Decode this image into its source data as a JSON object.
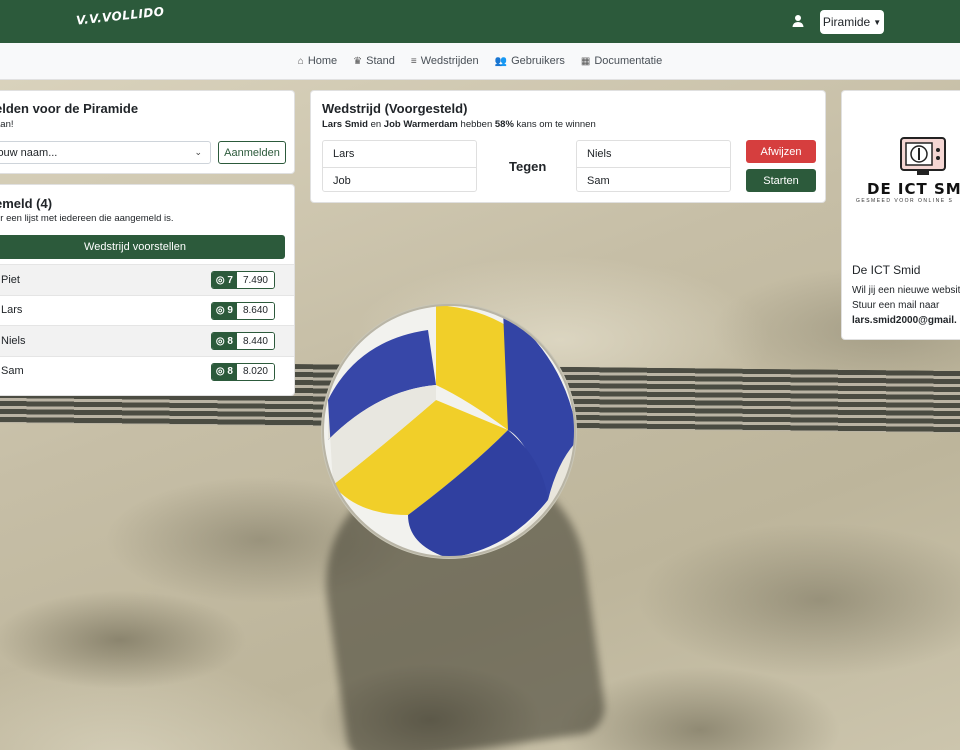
{
  "header": {
    "logo_text": "V.V.VOLLIDO",
    "dropdown_label": "Piramide"
  },
  "nav": {
    "items": [
      {
        "label": "Home",
        "icon": "home-icon"
      },
      {
        "label": "Stand",
        "icon": "crown-icon"
      },
      {
        "label": "Wedstrijden",
        "icon": "list-icon"
      },
      {
        "label": "Gebruikers",
        "icon": "users-icon"
      },
      {
        "label": "Documentatie",
        "icon": "boxes-icon"
      }
    ]
  },
  "signup": {
    "title": "elden voor de Piramide",
    "subtitle": "aan!",
    "select_value": "jouw naam...",
    "button": "Aanmelden"
  },
  "registered": {
    "title": "emeld (4)",
    "subtitle": "er een lijst met iedereen die aangemeld is.",
    "propose_button": "Wedstrijd voorstellen",
    "players": [
      {
        "name": "Piet",
        "rank": "7",
        "score": "7.490"
      },
      {
        "name": "Lars",
        "rank": "9",
        "score": "8.640"
      },
      {
        "name": "Niels",
        "rank": "8",
        "score": "8.440"
      },
      {
        "name": "Sam",
        "rank": "8",
        "score": "8.020"
      }
    ]
  },
  "match": {
    "title": "Wedstrijd (Voorgesteld)",
    "player_a": "Lars Smid",
    "joiner": "en",
    "player_b": "Job Warmerdam",
    "verb": "hebben",
    "chance": "58%",
    "suffix": "kans om te winnen",
    "team_a": [
      "Lars",
      "Job"
    ],
    "versus": "Tegen",
    "team_b": [
      "Niels",
      "Sam"
    ],
    "reject_button": "Afwijzen",
    "start_button": "Starten"
  },
  "ad": {
    "brand": "DE ICT SMI",
    "tagline": "GESMEED VOOR ONLINE S",
    "title": "De ICT Smid",
    "line1": "Wil jij een nieuwe websit",
    "line2": "Stuur een mail naar",
    "email": "lars.smid2000@gmail."
  },
  "colors": {
    "primary": "#2c5a3b",
    "danger": "#d63e3e",
    "nav_bg": "#f8f9fa"
  }
}
